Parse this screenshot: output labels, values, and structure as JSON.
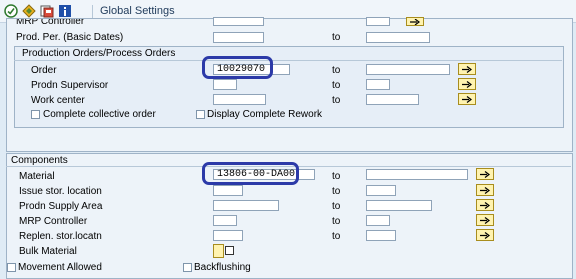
{
  "toolbar": {
    "title": "Global Settings",
    "icons": [
      "execute-icon",
      "variant-icon",
      "save-variant-icon",
      "info-icon"
    ]
  },
  "top": {
    "mrp_controller_label": "MRP Controller",
    "prod_per_label": "Prod. Per. (Basic Dates)",
    "to": "to"
  },
  "prod_orders": {
    "title": "Production Orders/Process Orders",
    "order_label": "Order",
    "order_value": "10029070",
    "supervisor_label": "Prodn Supervisor",
    "workcenter_label": "Work center",
    "to": "to",
    "complete_collective_label": "Complete collective order",
    "display_rework_label": "Display Complete Rework"
  },
  "components": {
    "title": "Components",
    "material_label": "Material",
    "material_value": "13806-00-DA00",
    "issue_loc_label": "Issue stor. location",
    "supply_area_label": "Prodn Supply Area",
    "mrp_controller_label": "MRP Controller",
    "replen_label": "Replen. stor.locatn",
    "bulk_label": "Bulk Material",
    "movement_allowed_label": "Movement Allowed",
    "backflushing_label": "Backflushing",
    "to": "to"
  }
}
